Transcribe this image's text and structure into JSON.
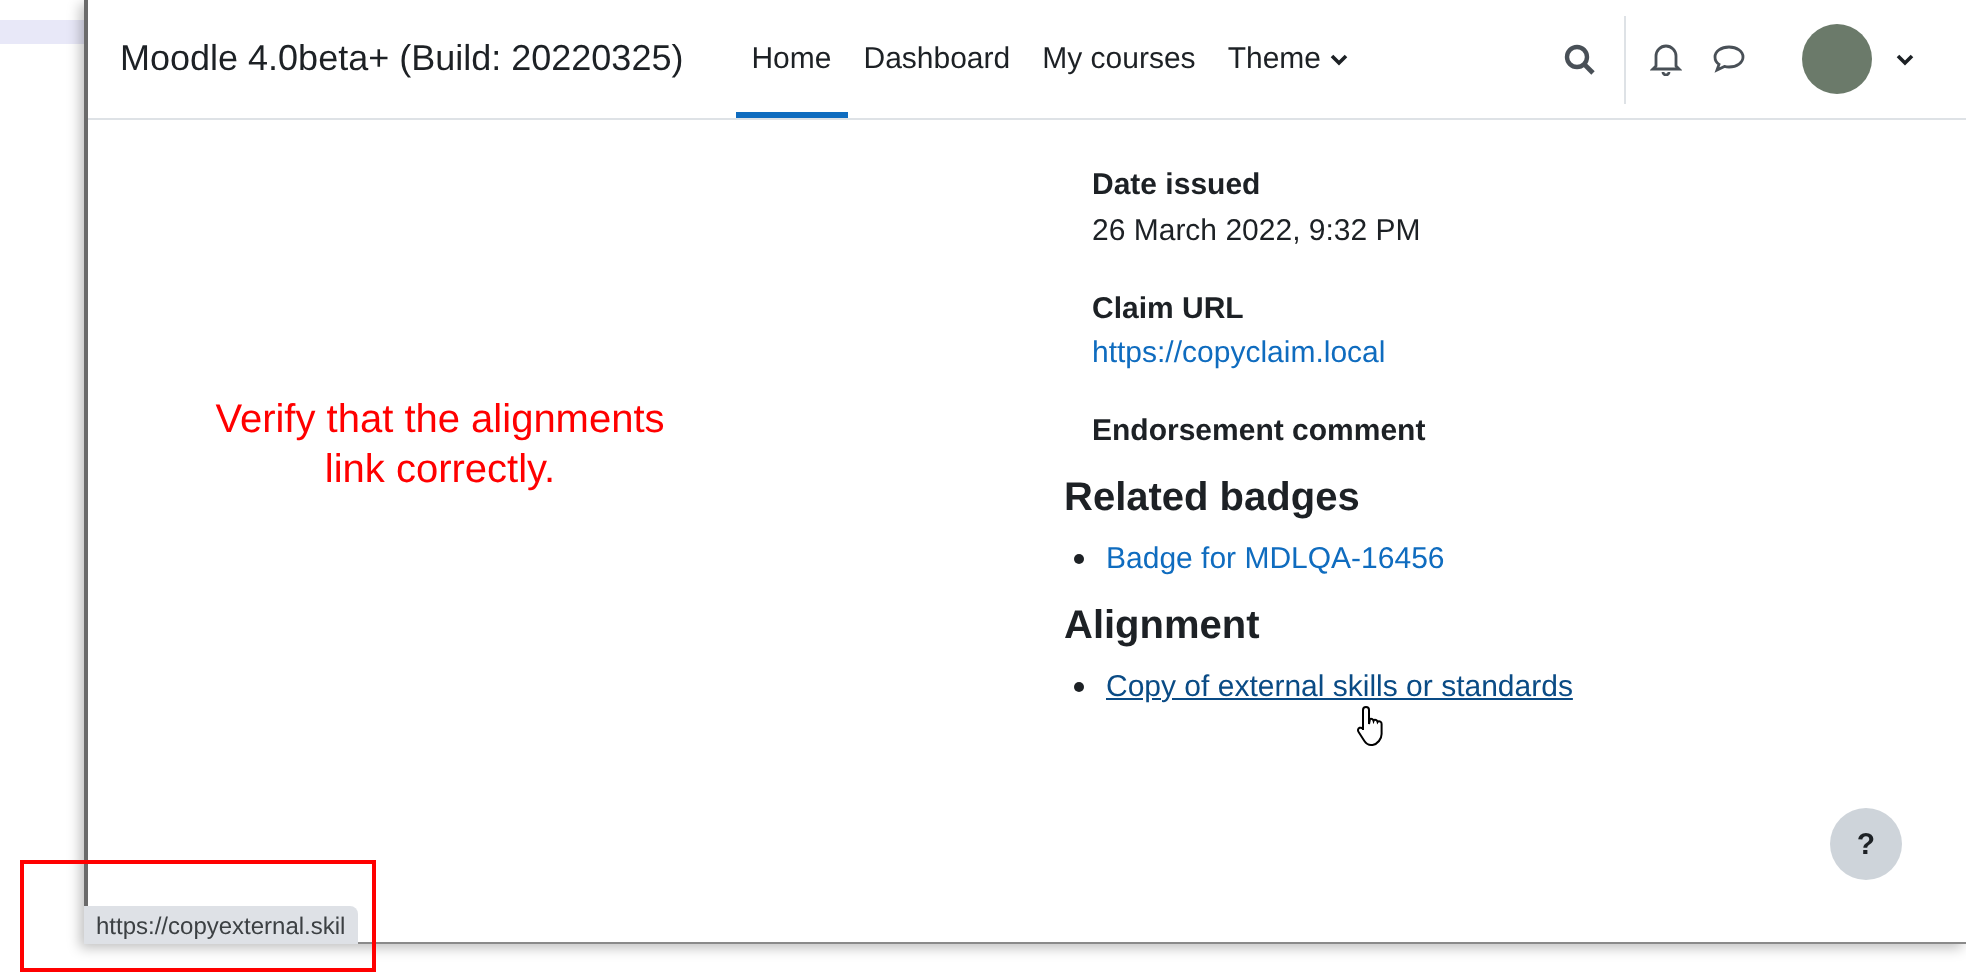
{
  "site_name": "Moodle 4.0beta+ (Build: 20220325)",
  "nav": [
    {
      "label": "Home",
      "selected": true,
      "kind": "link"
    },
    {
      "label": "Dashboard",
      "selected": false,
      "kind": "link"
    },
    {
      "label": "My courses",
      "selected": false,
      "kind": "link"
    },
    {
      "label": "Theme",
      "selected": false,
      "kind": "dropdown"
    }
  ],
  "details": [
    {
      "label": "Date issued",
      "value": "26 March 2022, 9:32 PM",
      "kind": "text"
    },
    {
      "label": "Claim URL",
      "value": "https://copyclaim.local",
      "kind": "link"
    },
    {
      "label": "Endorsement comment",
      "kind": "empty"
    }
  ],
  "sections": [
    {
      "title": "Related badges",
      "items": [
        {
          "label": "Badge for MDLQA-16456",
          "hovered": false
        }
      ]
    },
    {
      "title": "Alignment",
      "items": [
        {
          "label": "Copy of external skills or standards",
          "hovered": true
        }
      ]
    }
  ],
  "help_button": "?",
  "annotation": "Verify that the alignments link correctly.",
  "status_url": "https://copyexternal.skil"
}
